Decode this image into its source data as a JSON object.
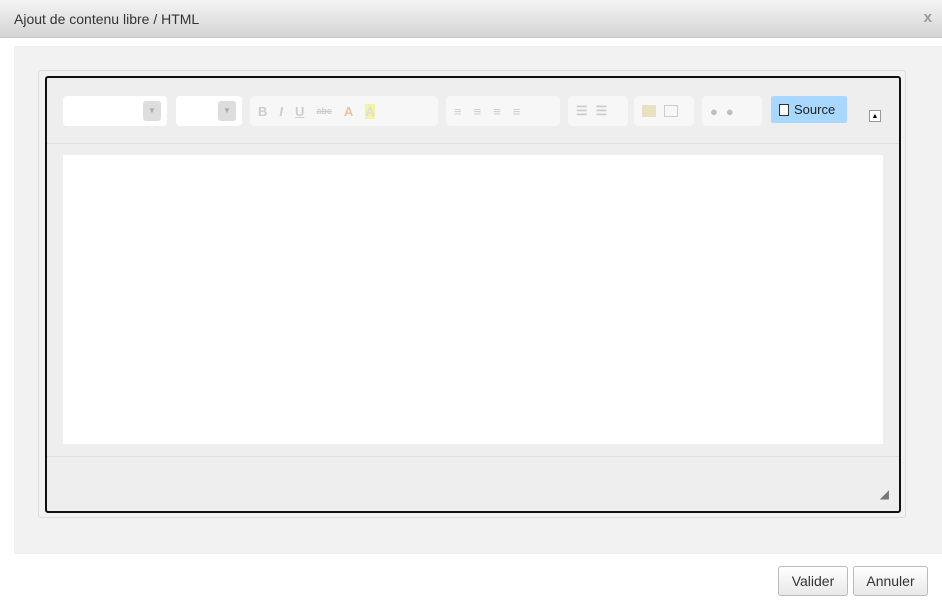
{
  "dialog": {
    "title": "Ajout de contenu libre / HTML",
    "close": "x"
  },
  "toolbar": {
    "bold": "B",
    "italic": "I",
    "underline": "U",
    "strike": "abc",
    "font_color": "A",
    "bg_color": "A",
    "source_label": "Source"
  },
  "buttons": {
    "validate": "Valider",
    "cancel": "Annuler"
  }
}
